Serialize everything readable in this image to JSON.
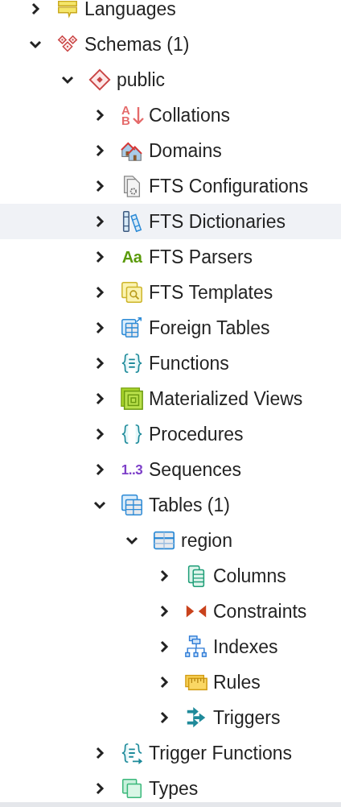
{
  "tree": [
    {
      "label": "Languages",
      "kind": "languages",
      "expanded": false,
      "selected": false
    },
    {
      "label": "Schemas (1)",
      "kind": "schemas",
      "expanded": true,
      "selected": false,
      "children": [
        {
          "label": "public",
          "kind": "schema",
          "expanded": true,
          "selected": false,
          "children": [
            {
              "label": "Collations",
              "kind": "collations",
              "icon_text": "AB",
              "expanded": false,
              "selected": false
            },
            {
              "label": "Domains",
              "kind": "domains",
              "expanded": false,
              "selected": false
            },
            {
              "label": "FTS Configurations",
              "kind": "fts_configurations",
              "expanded": false,
              "selected": false
            },
            {
              "label": "FTS Dictionaries",
              "kind": "fts_dictionaries",
              "expanded": false,
              "selected": true
            },
            {
              "label": "FTS Parsers",
              "kind": "fts_parsers",
              "icon_text": "Aa",
              "expanded": false,
              "selected": false
            },
            {
              "label": "FTS Templates",
              "kind": "fts_templates",
              "expanded": false,
              "selected": false
            },
            {
              "label": "Foreign Tables",
              "kind": "foreign_tables",
              "expanded": false,
              "selected": false
            },
            {
              "label": "Functions",
              "kind": "functions",
              "expanded": false,
              "selected": false
            },
            {
              "label": "Materialized Views",
              "kind": "materialized_views",
              "expanded": false,
              "selected": false
            },
            {
              "label": "Procedures",
              "kind": "procedures",
              "expanded": false,
              "selected": false
            },
            {
              "label": "Sequences",
              "kind": "sequences",
              "icon_text": "1..3",
              "expanded": false,
              "selected": false
            },
            {
              "label": "Tables (1)",
              "kind": "tables",
              "expanded": true,
              "selected": false,
              "children": [
                {
                  "label": "region",
                  "kind": "table",
                  "expanded": true,
                  "selected": false,
                  "children": [
                    {
                      "label": "Columns",
                      "kind": "columns",
                      "expanded": false,
                      "selected": false
                    },
                    {
                      "label": "Constraints",
                      "kind": "constraints",
                      "expanded": false,
                      "selected": false
                    },
                    {
                      "label": "Indexes",
                      "kind": "indexes",
                      "expanded": false,
                      "selected": false
                    },
                    {
                      "label": "Rules",
                      "kind": "rules",
                      "expanded": false,
                      "selected": false
                    },
                    {
                      "label": "Triggers",
                      "kind": "triggers",
                      "expanded": false,
                      "selected": false
                    }
                  ]
                }
              ]
            },
            {
              "label": "Trigger Functions",
              "kind": "trigger_functions",
              "expanded": false,
              "selected": false
            },
            {
              "label": "Types",
              "kind": "types",
              "expanded": false,
              "selected": false
            }
          ]
        }
      ]
    }
  ]
}
